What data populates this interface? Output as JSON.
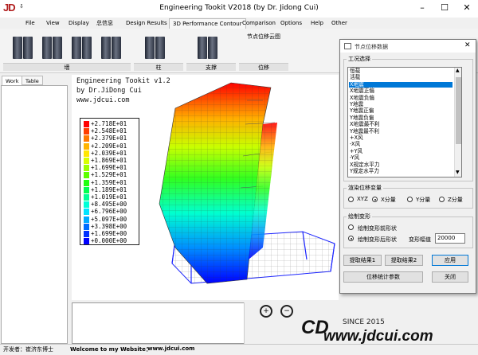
{
  "window": {
    "title": "Engineering Tookit V2018 (by Dr. Jidong Cui)",
    "logo_text": "JD"
  },
  "menu": [
    "File",
    "View",
    "Display",
    "总信息",
    "Design Results",
    "3D Performance Contour",
    "Comparison",
    "Options",
    "Help",
    "Other"
  ],
  "ribbon": {
    "groups": [
      "墙",
      "柱",
      "支撑",
      "位移"
    ],
    "displacement_button": "节点位移云图"
  },
  "left_tabs": [
    "Work",
    "Table"
  ],
  "canvas": {
    "line1": "Engineering Tookit v1.2",
    "line2": "by Dr.JiDong Cui",
    "line3": "www.jdcui.com"
  },
  "legend": {
    "values": [
      "+2.718E+01",
      "+2.548E+01",
      "+2.379E+01",
      "+2.209E+01",
      "+2.039E+01",
      "+1.869E+01",
      "+1.699E+01",
      "+1.529E+01",
      "+1.359E+01",
      "+1.189E+01",
      "+1.019E+01",
      "+8.495E+00",
      "+6.796E+00",
      "+5.097E+00",
      "+3.398E+00",
      "+1.699E+00",
      "+0.000E+00"
    ],
    "colors": [
      "#ff0000",
      "#ff3c00",
      "#ff7800",
      "#ffb400",
      "#ffe600",
      "#d8ff00",
      "#9cff00",
      "#5cff00",
      "#20ff10",
      "#00ff50",
      "#00ff96",
      "#00ffd8",
      "#00e4ff",
      "#00aaff",
      "#006cff",
      "#0030ff",
      "#0000ff"
    ]
  },
  "dialog": {
    "title": "节点位移数据",
    "case_section": "工况选择",
    "cases": [
      "恒载",
      "活载",
      "X地震",
      "X地震正偏",
      "X地震负偏",
      "Y地震",
      "Y地震正偏",
      "Y地震负偏",
      "X地震最不利",
      "Y地震最不利",
      "+X风",
      "-X风",
      "+Y风",
      "-Y风",
      "X规定水平力",
      "Y规定水平力"
    ],
    "selected_case_index": 2,
    "component_section": "渲染位移变量",
    "components": [
      "XYZ",
      "X分量",
      "Y分量",
      "Z分量"
    ],
    "selected_component_index": 1,
    "deform_section": "绘制变形",
    "deform_options": [
      "绘制变形前形状",
      "绘制变形后形状"
    ],
    "selected_deform_index": 1,
    "scale_label": "变形幅值",
    "scale_value": "20000",
    "buttons": {
      "extract1": "提取结果1",
      "extract2": "提取结果2",
      "apply": "应用",
      "stats": "位移统计参数",
      "close": "关闭"
    }
  },
  "watermark": {
    "logo": "CD",
    "since": "SINCE 2015",
    "url": "www.jdcui.com"
  },
  "status": {
    "author": "开发者：崔济东博士",
    "welcome": "Welcome to my Website：",
    "site": "www.jdcui.com"
  }
}
